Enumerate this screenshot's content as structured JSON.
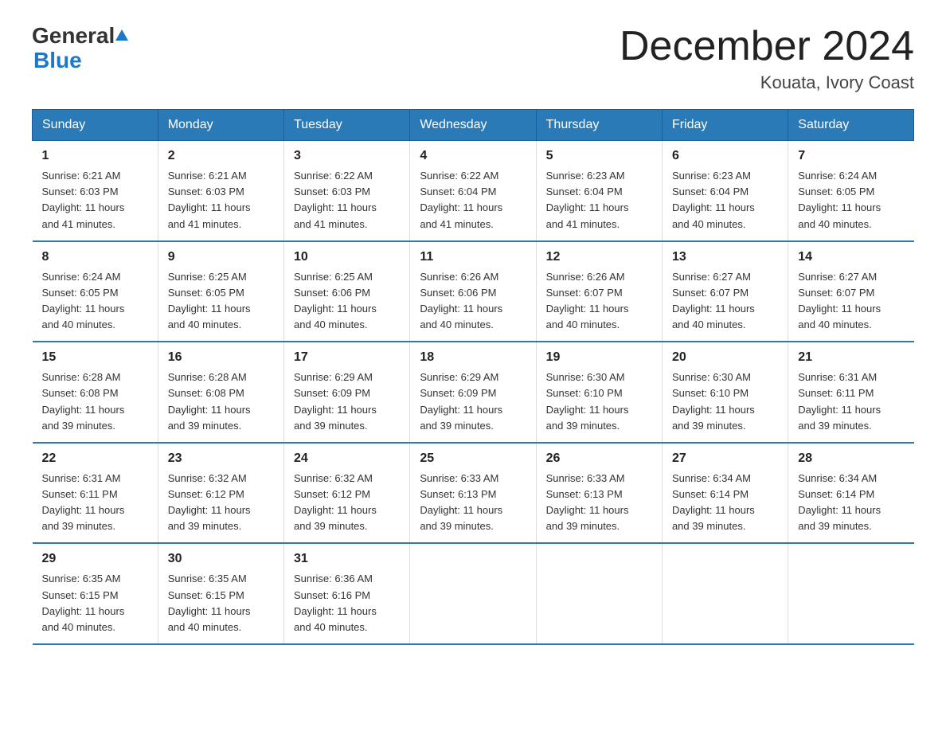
{
  "header": {
    "logo_general": "General",
    "logo_blue": "Blue",
    "main_title": "December 2024",
    "subtitle": "Kouata, Ivory Coast"
  },
  "calendar": {
    "days_of_week": [
      "Sunday",
      "Monday",
      "Tuesday",
      "Wednesday",
      "Thursday",
      "Friday",
      "Saturday"
    ],
    "weeks": [
      [
        {
          "day": "1",
          "sunrise": "6:21 AM",
          "sunset": "6:03 PM",
          "daylight": "11 hours and 41 minutes."
        },
        {
          "day": "2",
          "sunrise": "6:21 AM",
          "sunset": "6:03 PM",
          "daylight": "11 hours and 41 minutes."
        },
        {
          "day": "3",
          "sunrise": "6:22 AM",
          "sunset": "6:03 PM",
          "daylight": "11 hours and 41 minutes."
        },
        {
          "day": "4",
          "sunrise": "6:22 AM",
          "sunset": "6:04 PM",
          "daylight": "11 hours and 41 minutes."
        },
        {
          "day": "5",
          "sunrise": "6:23 AM",
          "sunset": "6:04 PM",
          "daylight": "11 hours and 41 minutes."
        },
        {
          "day": "6",
          "sunrise": "6:23 AM",
          "sunset": "6:04 PM",
          "daylight": "11 hours and 40 minutes."
        },
        {
          "day": "7",
          "sunrise": "6:24 AM",
          "sunset": "6:05 PM",
          "daylight": "11 hours and 40 minutes."
        }
      ],
      [
        {
          "day": "8",
          "sunrise": "6:24 AM",
          "sunset": "6:05 PM",
          "daylight": "11 hours and 40 minutes."
        },
        {
          "day": "9",
          "sunrise": "6:25 AM",
          "sunset": "6:05 PM",
          "daylight": "11 hours and 40 minutes."
        },
        {
          "day": "10",
          "sunrise": "6:25 AM",
          "sunset": "6:06 PM",
          "daylight": "11 hours and 40 minutes."
        },
        {
          "day": "11",
          "sunrise": "6:26 AM",
          "sunset": "6:06 PM",
          "daylight": "11 hours and 40 minutes."
        },
        {
          "day": "12",
          "sunrise": "6:26 AM",
          "sunset": "6:07 PM",
          "daylight": "11 hours and 40 minutes."
        },
        {
          "day": "13",
          "sunrise": "6:27 AM",
          "sunset": "6:07 PM",
          "daylight": "11 hours and 40 minutes."
        },
        {
          "day": "14",
          "sunrise": "6:27 AM",
          "sunset": "6:07 PM",
          "daylight": "11 hours and 40 minutes."
        }
      ],
      [
        {
          "day": "15",
          "sunrise": "6:28 AM",
          "sunset": "6:08 PM",
          "daylight": "11 hours and 39 minutes."
        },
        {
          "day": "16",
          "sunrise": "6:28 AM",
          "sunset": "6:08 PM",
          "daylight": "11 hours and 39 minutes."
        },
        {
          "day": "17",
          "sunrise": "6:29 AM",
          "sunset": "6:09 PM",
          "daylight": "11 hours and 39 minutes."
        },
        {
          "day": "18",
          "sunrise": "6:29 AM",
          "sunset": "6:09 PM",
          "daylight": "11 hours and 39 minutes."
        },
        {
          "day": "19",
          "sunrise": "6:30 AM",
          "sunset": "6:10 PM",
          "daylight": "11 hours and 39 minutes."
        },
        {
          "day": "20",
          "sunrise": "6:30 AM",
          "sunset": "6:10 PM",
          "daylight": "11 hours and 39 minutes."
        },
        {
          "day": "21",
          "sunrise": "6:31 AM",
          "sunset": "6:11 PM",
          "daylight": "11 hours and 39 minutes."
        }
      ],
      [
        {
          "day": "22",
          "sunrise": "6:31 AM",
          "sunset": "6:11 PM",
          "daylight": "11 hours and 39 minutes."
        },
        {
          "day": "23",
          "sunrise": "6:32 AM",
          "sunset": "6:12 PM",
          "daylight": "11 hours and 39 minutes."
        },
        {
          "day": "24",
          "sunrise": "6:32 AM",
          "sunset": "6:12 PM",
          "daylight": "11 hours and 39 minutes."
        },
        {
          "day": "25",
          "sunrise": "6:33 AM",
          "sunset": "6:13 PM",
          "daylight": "11 hours and 39 minutes."
        },
        {
          "day": "26",
          "sunrise": "6:33 AM",
          "sunset": "6:13 PM",
          "daylight": "11 hours and 39 minutes."
        },
        {
          "day": "27",
          "sunrise": "6:34 AM",
          "sunset": "6:14 PM",
          "daylight": "11 hours and 39 minutes."
        },
        {
          "day": "28",
          "sunrise": "6:34 AM",
          "sunset": "6:14 PM",
          "daylight": "11 hours and 39 minutes."
        }
      ],
      [
        {
          "day": "29",
          "sunrise": "6:35 AM",
          "sunset": "6:15 PM",
          "daylight": "11 hours and 40 minutes."
        },
        {
          "day": "30",
          "sunrise": "6:35 AM",
          "sunset": "6:15 PM",
          "daylight": "11 hours and 40 minutes."
        },
        {
          "day": "31",
          "sunrise": "6:36 AM",
          "sunset": "6:16 PM",
          "daylight": "11 hours and 40 minutes."
        },
        null,
        null,
        null,
        null
      ]
    ],
    "sunrise_label": "Sunrise:",
    "sunset_label": "Sunset:",
    "daylight_label": "Daylight:"
  },
  "colors": {
    "header_bg": "#2a7ab8",
    "header_text": "#ffffff",
    "border_color": "#2a7ab8"
  }
}
